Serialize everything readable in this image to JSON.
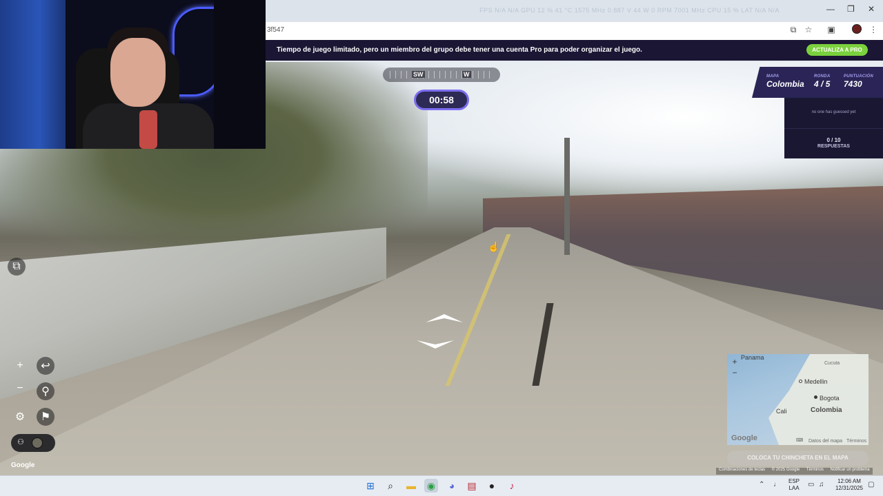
{
  "titlebar": {
    "stats": "FPS N/A N/A   GPU 12 % 41 °C 1575 MHz 0.887 V 44 W 0 RPM 7001 MHz   CPU 15 %   LAT N/A N/A",
    "min": "—",
    "restore": "❐",
    "close": "✕"
  },
  "addressbar": {
    "url": "3f547"
  },
  "banner": {
    "text": "Tiempo de juego limitado, pero un miembro del grupo debe tener una cuenta Pro para poder organizar el juego.",
    "button": "ACTUALIZA A PRO"
  },
  "compass": {
    "sw": "SW",
    "w": "W"
  },
  "timer": "00:58",
  "scoreboard": {
    "map_label": "MAPA",
    "map_value": "Colombia",
    "round_label": "RONDA",
    "round_value": "4 / 5",
    "score_label": "PUNTUACIÓN",
    "score_value": "7430"
  },
  "guesses": {
    "none_text": "no one has guessed yet",
    "count": "0 / 10",
    "label": "RESPUESTAS"
  },
  "controls": {
    "zoom_in": "+",
    "zoom_out": "−",
    "undo": "↩",
    "pin": "⚲",
    "settings": "⚙",
    "flag": "⚑",
    "chat": "⧉"
  },
  "google_logo": "Google",
  "minimap": {
    "labels": {
      "panama": "Panama",
      "cucuta": "Cucuta",
      "medellin": "Medellin",
      "bogota": "Bogota",
      "cali": "Cali",
      "colombia": "Colombia"
    },
    "google": "Google",
    "keyboard": "⌨",
    "map_data": "Datos del mapa",
    "terms": "Términos",
    "zoom_in": "+",
    "zoom_out": "−"
  },
  "place_pin": "COLOCA TU CHINCHETA EN EL MAPA",
  "attribution": {
    "shortcuts": "Combinaciones de teclas",
    "copyright": "© 2025 Google",
    "terms": "Términos",
    "report": "Notificar un problema"
  },
  "taskbar": {
    "lang_top": "ESP",
    "lang_bottom": "LAA",
    "time": "12:06 AM",
    "date": "12/31/2025"
  }
}
